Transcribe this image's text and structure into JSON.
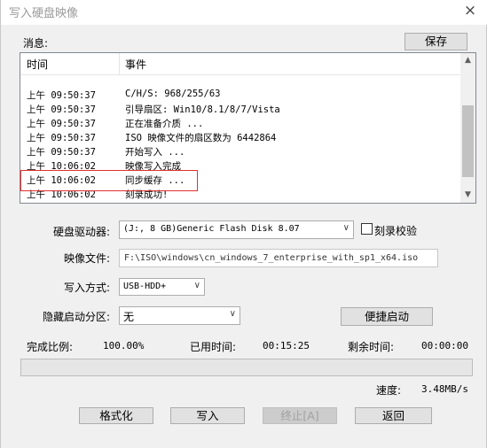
{
  "window": {
    "title": "写入硬盘映像",
    "close_glyph": "×"
  },
  "messages_label": "消息:",
  "save_button": "保存",
  "log": {
    "headers": {
      "time": "时间",
      "event": "事件"
    },
    "rows": [
      {
        "time": "上午 09:50:37",
        "event": "C/H/S: 968/255/63"
      },
      {
        "time": "上午 09:50:37",
        "event": "引导扇区: Win10/8.1/8/7/Vista"
      },
      {
        "time": "上午 09:50:37",
        "event": "正在准备介质 ..."
      },
      {
        "time": "上午 09:50:37",
        "event": "ISO 映像文件的扇区数为 6442864"
      },
      {
        "time": "上午 09:50:37",
        "event": "开始写入 ..."
      },
      {
        "time": "上午 10:06:02",
        "event": "映像写入完成"
      },
      {
        "time": "上午 10:06:02",
        "event": "同步缓存 ..."
      },
      {
        "time": "上午 10:06:02",
        "event": "刻录成功!"
      }
    ]
  },
  "scroll_up_glyph": "▲",
  "scroll_down_glyph": "▼",
  "form": {
    "drive_label": "硬盘驱动器:",
    "drive_value": "(J:, 8 GB)Generic Flash Disk         8.07",
    "verify_label": "刻录校验",
    "image_label": "映像文件:",
    "image_value": "F:\\ISO\\windows\\cn_windows_7_enterprise_with_sp1_x64.iso",
    "write_mode_label": "写入方式:",
    "write_mode_value": "USB-HDD+",
    "hidden_partition_label": "隐藏启动分区:",
    "hidden_partition_value": "无",
    "quick_boot_button": "便捷启动",
    "dropdown_glyph": "∨"
  },
  "status": {
    "progress_label": "完成比例:",
    "progress_value": "100.00%",
    "progress_fraction": 1.0,
    "elapsed_label": "已用时间:",
    "elapsed_value": "00:15:25",
    "remaining_label": "剩余时间:",
    "remaining_value": "00:00:00",
    "speed_label": "速度:",
    "speed_value": "3.48MB/s"
  },
  "buttons": {
    "format": "格式化",
    "write": "写入",
    "stop": "终止[A]",
    "back": "返回"
  }
}
